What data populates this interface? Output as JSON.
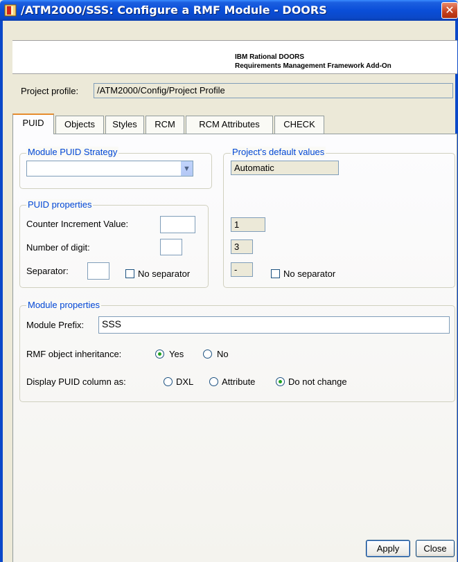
{
  "window": {
    "title": "/ATM2000/SSS: Configure a RMF Module - DOORS",
    "close_symbol": "✕",
    "icon": "doors-app-icon"
  },
  "banner": {
    "line1": "IBM Rational DOORS",
    "line2": "Requirements Management Framework Add-On"
  },
  "project_profile": {
    "label": "Project profile:",
    "value": "/ATM2000/Config/Project Profile"
  },
  "tabs": [
    {
      "label": "PUID",
      "active": true
    },
    {
      "label": "Objects",
      "active": false
    },
    {
      "label": "Styles",
      "active": false
    },
    {
      "label": "RCM",
      "active": false
    },
    {
      "label": "RCM Attributes",
      "active": false
    },
    {
      "label": "CHECK",
      "active": false
    }
  ],
  "strategy": {
    "title": "Module PUID Strategy",
    "selected": ""
  },
  "defaults": {
    "title": "Project's default values",
    "strategy": "Automatic",
    "counter_increment": "1",
    "digits": "3",
    "separator": "-",
    "no_separator_label": "No separator",
    "no_separator_checked": false
  },
  "puid_properties": {
    "title": "PUID properties",
    "counter_label": "Counter Increment Value:",
    "counter_value": "",
    "digits_label": "Number of digit:",
    "digits_value": "",
    "separator_label": "Separator:",
    "separator_value": "",
    "no_separator_label": "No separator",
    "no_separator_checked": false
  },
  "module_properties": {
    "title": "Module properties",
    "prefix_label": "Module Prefix:",
    "prefix_value": "SSS",
    "inheritance_label": "RMF object inheritance:",
    "inheritance_options": [
      "Yes",
      "No"
    ],
    "inheritance_selected": "Yes",
    "display_label": "Display PUID column as:",
    "display_options": [
      "DXL",
      "Attribute",
      "Do not change"
    ],
    "display_selected": "Do not change"
  },
  "buttons": {
    "apply": "Apply",
    "close": "Close"
  },
  "colors": {
    "titlebar": "#0A4ED8",
    "group_title": "#0046D5",
    "active_tab_accent": "#E68B2C",
    "radio_dot": "#21A121"
  }
}
